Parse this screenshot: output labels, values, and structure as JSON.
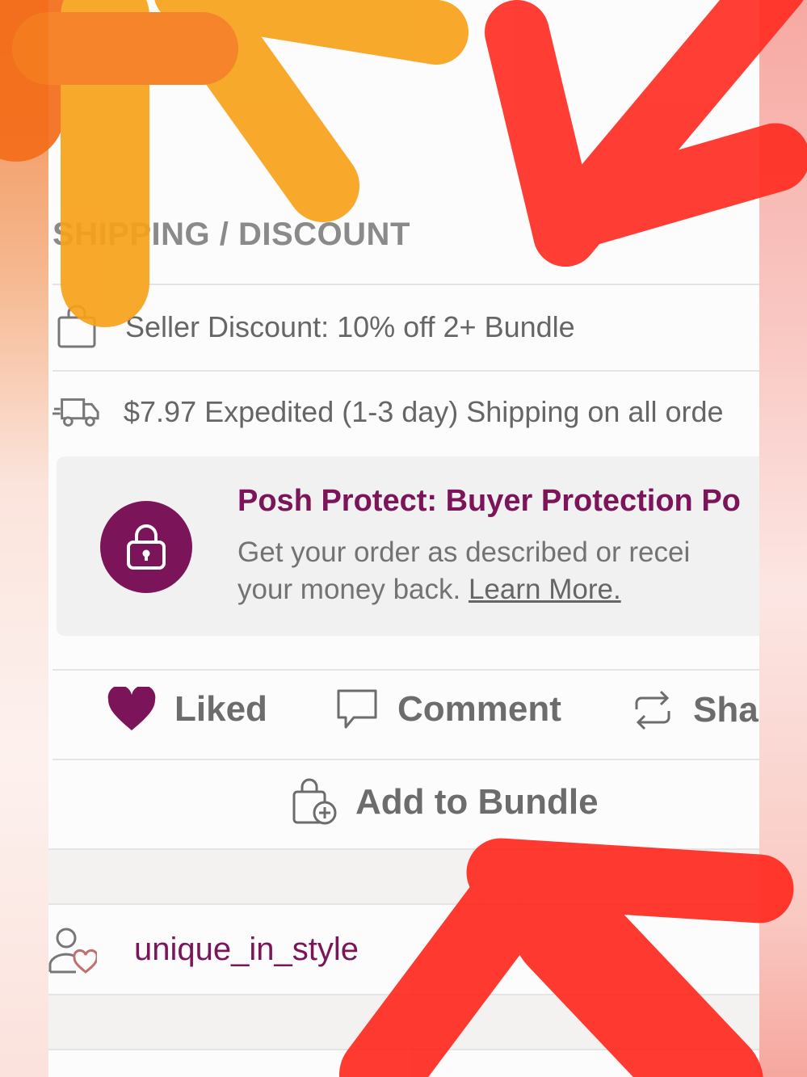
{
  "section": {
    "header": "SHIPPING / DISCOUNT"
  },
  "shipping": {
    "discount_text": "Seller Discount: 10% off 2+ Bundle",
    "expedited_text": "$7.97 Expedited (1-3 day) Shipping on all orde"
  },
  "protect": {
    "title": "Posh Protect: Buyer Protection Po",
    "line1": "Get your order as described or recei",
    "line2_prefix": "your money back. ",
    "learn_more": "Learn More."
  },
  "actions": {
    "liked": "Liked",
    "comment": "Comment",
    "share": "Sha",
    "add_to_bundle": "Add to Bundle"
  },
  "seller": {
    "username": "unique_in_style"
  },
  "colors": {
    "brand": "#7b1459",
    "text_gray": "#6c6c6c",
    "divider": "#e4e4e4",
    "marker_orange": "#f7931e",
    "marker_red": "#ff2a1f"
  },
  "icons": [
    "bag-icon",
    "truck-icon",
    "lock-icon",
    "heart-icon",
    "comment-icon",
    "share-icon",
    "add-bundle-icon",
    "seller-icon"
  ]
}
